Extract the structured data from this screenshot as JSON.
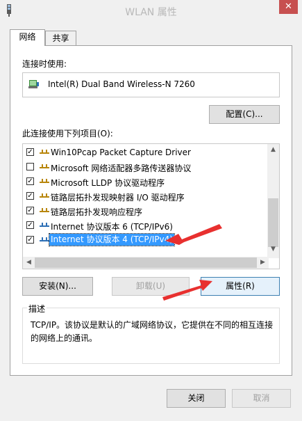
{
  "window": {
    "title": "WLAN 属性",
    "close_label": "✕"
  },
  "tabs": [
    {
      "label": "网络"
    },
    {
      "label": "共享"
    }
  ],
  "connect_using": {
    "label": "连接时使用:",
    "adapter": "Intel(R) Dual Band Wireless-N 7260",
    "configure_button": "配置(C)..."
  },
  "items_section": {
    "label": "此连接使用下列项目(O):",
    "items": [
      {
        "label": "Win10Pcap Packet Capture Driver",
        "checked": true
      },
      {
        "label": "Microsoft 网络适配器多路传送器协议",
        "checked": false
      },
      {
        "label": "Microsoft LLDP 协议驱动程序",
        "checked": true
      },
      {
        "label": "链路层拓扑发现映射器 I/O 驱动程序",
        "checked": true
      },
      {
        "label": "链路层拓扑发现响应程序",
        "checked": true
      },
      {
        "label": "Internet 协议版本 6 (TCP/IPv6)",
        "checked": true
      },
      {
        "label": "Internet 协议版本 4 (TCP/IPv4)",
        "checked": true,
        "selected": true
      }
    ],
    "check_mark": "✓"
  },
  "actions": {
    "install": "安装(N)...",
    "uninstall": "卸载(U)",
    "properties": "属性(R)"
  },
  "description": {
    "legend": "描述",
    "text": "TCP/IP。该协议是默认的广域网络协议，它提供在不同的相互连接的网络上的通讯。"
  },
  "footer": {
    "close": "关闭",
    "cancel": "取消"
  },
  "colors": {
    "selection": "#3399ff",
    "arrow": "#e8302f",
    "close_button": "#c75050"
  }
}
